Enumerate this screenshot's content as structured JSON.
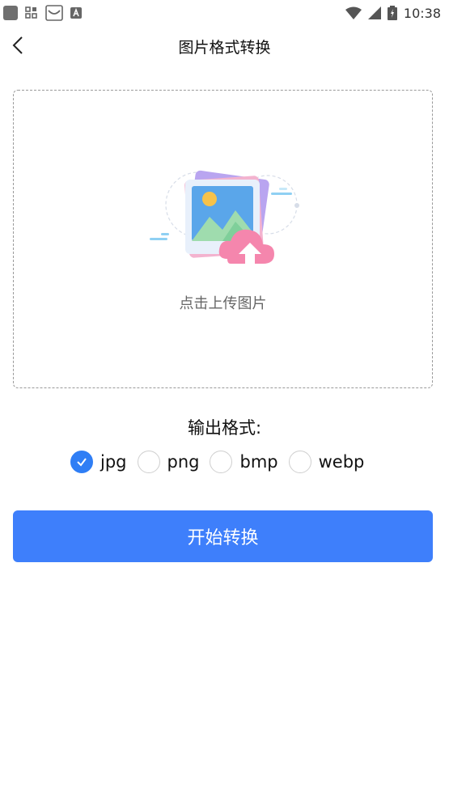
{
  "status_bar": {
    "time": "10:38",
    "icons": [
      "app-icon",
      "apps-icon",
      "mail-icon",
      "a-icon",
      "wifi-icon",
      "signal-icon",
      "battery-icon"
    ]
  },
  "header": {
    "title": "图片格式转换",
    "back_icon": "chevron-left-icon"
  },
  "upload": {
    "label": "点击上传图片",
    "icon": "image-upload-illustration"
  },
  "format": {
    "label": "输出格式:",
    "options": [
      {
        "label": "jpg",
        "checked": true
      },
      {
        "label": "png",
        "checked": false
      },
      {
        "label": "bmp",
        "checked": false
      },
      {
        "label": "webp",
        "checked": false
      }
    ]
  },
  "start_button": {
    "label": "开始转换"
  },
  "colors": {
    "accent": "#3e7ffb",
    "radio_checked": "#2f7ef5"
  }
}
